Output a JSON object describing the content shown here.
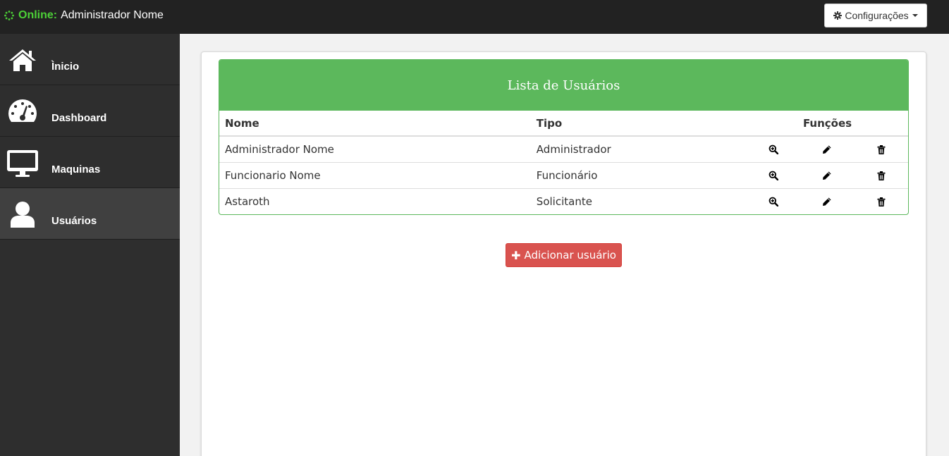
{
  "header": {
    "status_label": "Online:",
    "user_name": "Administrador Nome",
    "config_label": "Configurações"
  },
  "sidebar": {
    "items": [
      {
        "label": "Ìnicio",
        "icon": "home-icon"
      },
      {
        "label": "Dashboard",
        "icon": "dashboard-icon"
      },
      {
        "label": "Maquinas",
        "icon": "monitor-icon"
      },
      {
        "label": "Usuários",
        "icon": "user-icon",
        "active": true
      }
    ]
  },
  "main": {
    "card_title": "Lista de Usuários",
    "columns": {
      "nome": "Nome",
      "tipo": "Tipo",
      "funcoes": "Funções"
    },
    "rows": [
      {
        "nome": "Administrador Nome",
        "tipo": "Administrador"
      },
      {
        "nome": "Funcionario Nome",
        "tipo": "Funcionário"
      },
      {
        "nome": "Astaroth",
        "tipo": "Solicitante"
      }
    ],
    "row_actions": [
      "zoom-in-icon",
      "pencil-icon",
      "trash-icon"
    ],
    "add_button_label": "Adicionar usuário"
  },
  "colors": {
    "topbar": "#222222",
    "sidebar": "#2e2e2e",
    "sidebar_active": "#404040",
    "online": "#4cd137",
    "card_header": "#5cb85c",
    "add_button": "#d9534f"
  }
}
